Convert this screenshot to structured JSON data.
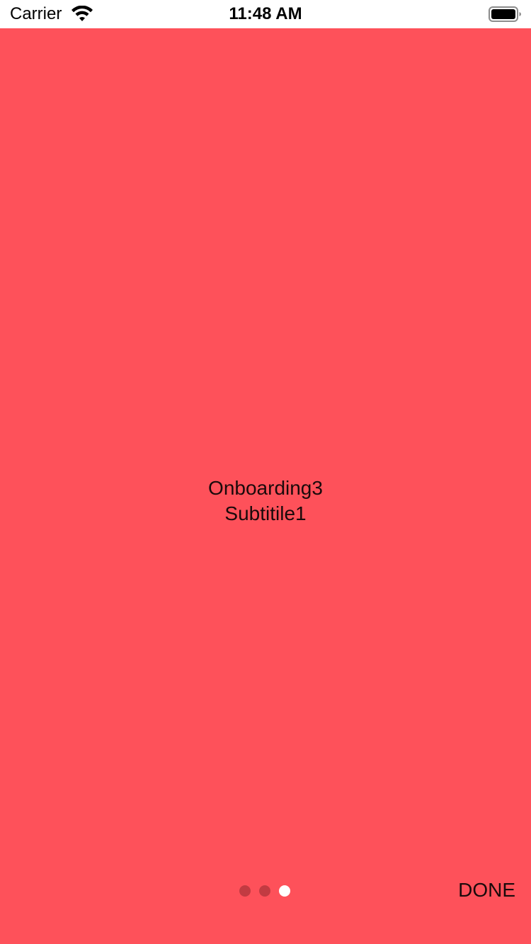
{
  "status_bar": {
    "carrier": "Carrier",
    "time": "11:48 AM",
    "wifi_icon": "wifi-icon",
    "battery_icon": "battery-icon"
  },
  "onboarding": {
    "title": "Onboarding3",
    "subtitle": "Subtitile1",
    "background_color": "#fe515a",
    "page_indicator": {
      "total_pages": 3,
      "current_page": 3,
      "active_color": "#ffffff",
      "inactive_color": "#c23b42"
    },
    "done_label": "DONE"
  }
}
